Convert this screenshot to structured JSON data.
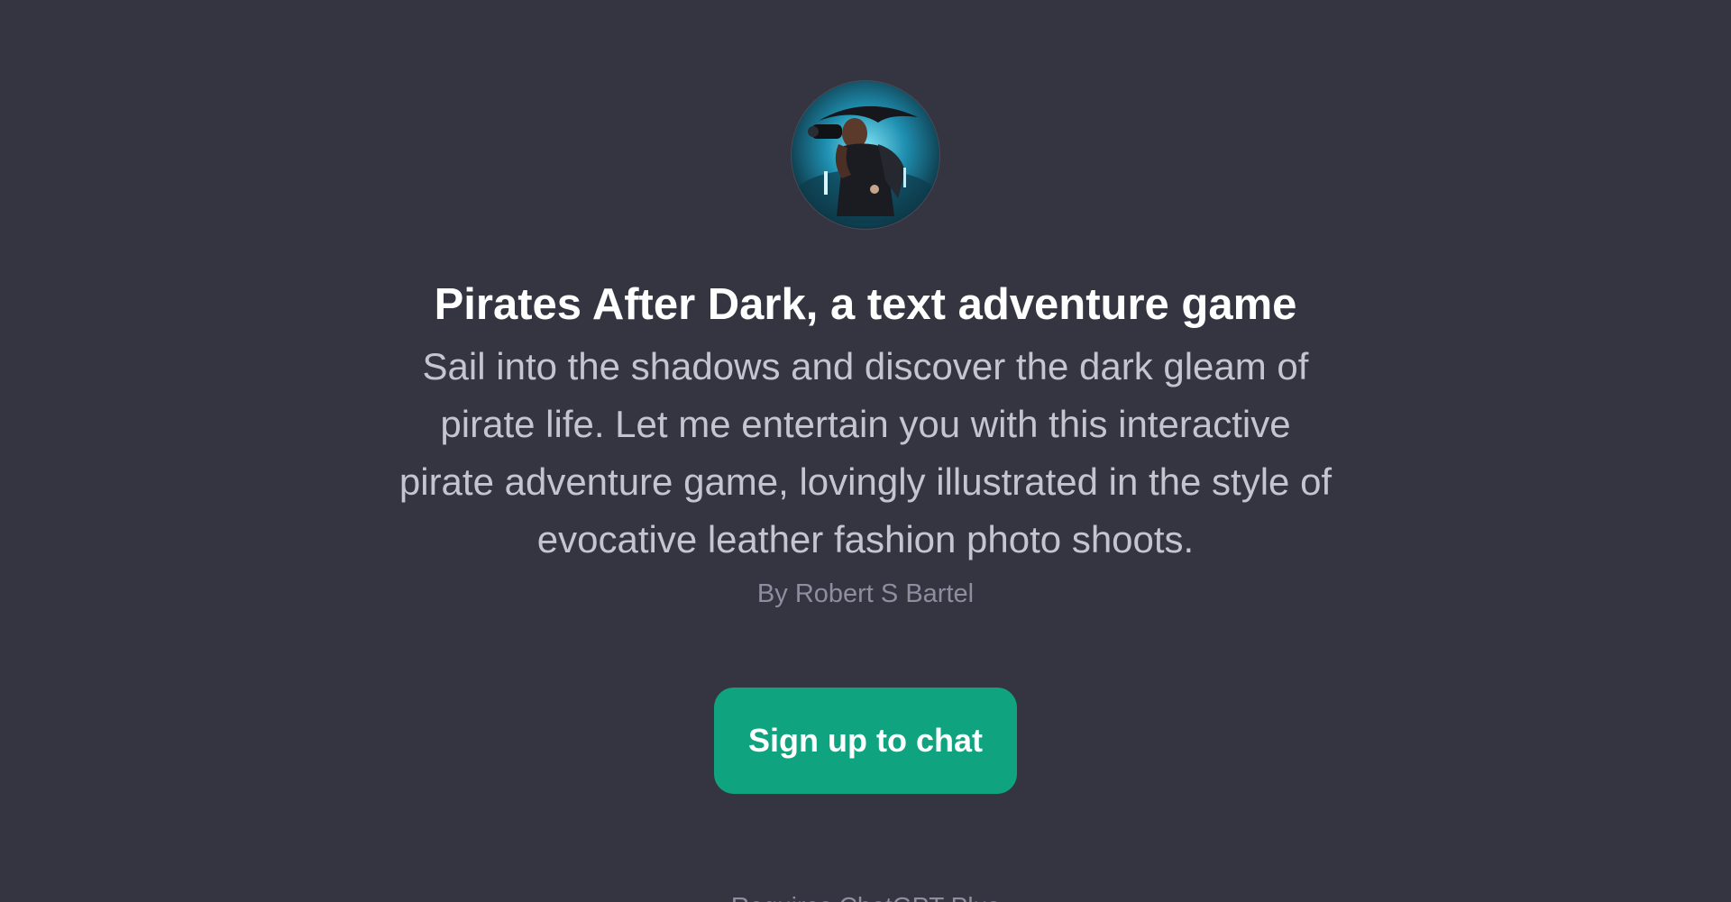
{
  "gpt": {
    "title": "Pirates After Dark, a text adventure game",
    "description": "Sail into the shadows and discover the dark gleam of pirate life. Let me entertain you with this interactive pirate adventure game, lovingly illustrated in the style of evocative leather fashion photo shoots.",
    "author": "By Robert S Bartel",
    "avatar_icon": "pirate-avatar"
  },
  "cta": {
    "signup_label": "Sign up to chat"
  },
  "footer": {
    "text": "Requires ChatGPT Plus"
  },
  "colors": {
    "background": "#343541",
    "accent": "#10a37f",
    "title": "#ffffff",
    "description": "#c5c5d2",
    "muted": "#8e8ea0"
  }
}
